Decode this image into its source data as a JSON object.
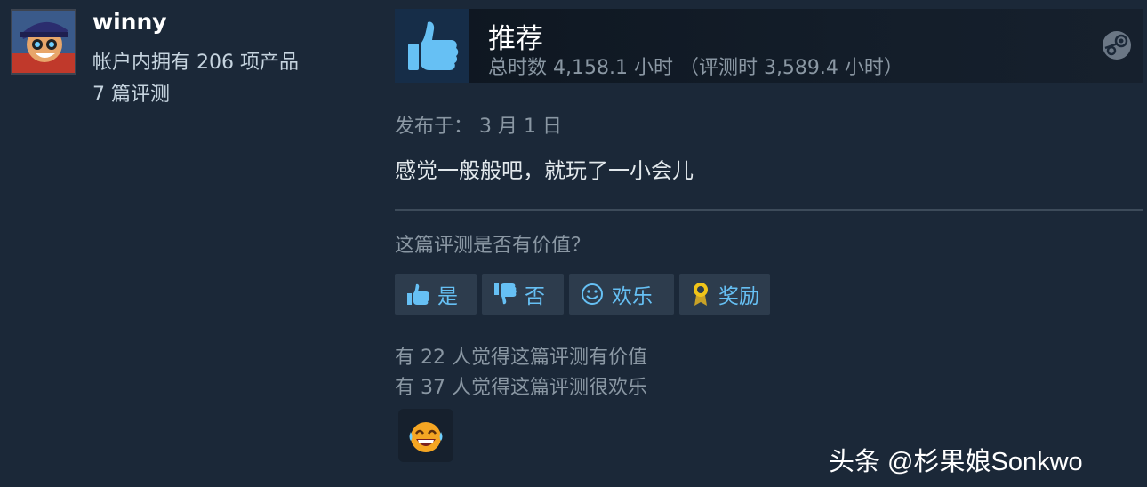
{
  "user": {
    "name": "winny",
    "products": "帐户内拥有 206 项产品",
    "reviews": "7 篇评测"
  },
  "recommendation": {
    "title": "推荐",
    "hours": "总时数 4,158.1 小时 （评测时 3,589.4 小时）"
  },
  "review": {
    "posted": "发布于： 3 月 1 日",
    "text": "感觉一般般吧，就玩了一小会儿"
  },
  "feedback": {
    "question": "这篇评测是否有价值？",
    "buttons": {
      "yes": "是",
      "no": "否",
      "funny": "欢乐",
      "award": "奖励"
    },
    "helpful_count": "有 22 人觉得这篇评测有价值",
    "funny_count": "有 37 人觉得这篇评测很欢乐"
  },
  "watermark": "头条 @杉果娘Sonkwo",
  "colors": {
    "background": "#1b2838",
    "accent": "#66c0f4",
    "muted_text": "#8a97a3"
  },
  "icons": [
    "thumbs-up-icon",
    "steam-icon",
    "thumbs-down-icon",
    "smiley-icon",
    "award-icon",
    "laughing-emoji-icon"
  ]
}
